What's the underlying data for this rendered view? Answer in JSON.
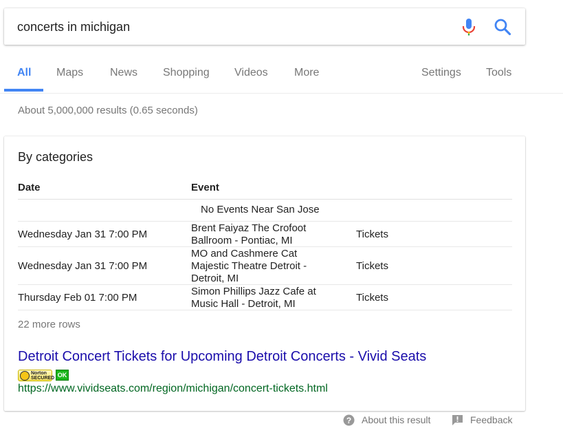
{
  "search": {
    "query": "concerts in michigan"
  },
  "nav": {
    "tabs": [
      {
        "label": "All"
      },
      {
        "label": "Maps"
      },
      {
        "label": "News"
      },
      {
        "label": "Shopping"
      },
      {
        "label": "Videos"
      },
      {
        "label": "More"
      }
    ],
    "settings_label": "Settings",
    "tools_label": "Tools",
    "active": "All"
  },
  "stats": "About 5,000,000 results (0.65 seconds)",
  "card": {
    "title": "By categories",
    "columns": {
      "date": "Date",
      "event": "Event"
    },
    "no_events": "No Events Near San Jose",
    "rows": [
      {
        "date": "Wednesday Jan 31 7:00 PM",
        "event": "Brent Faiyaz The Crofoot Ballroom - Pontiac, MI",
        "tickets": "Tickets"
      },
      {
        "date": "Wednesday Jan 31 7:00 PM",
        "event": "MO and Cashmere Cat Majestic Theatre Detroit - Detroit, MI",
        "tickets": "Tickets"
      },
      {
        "date": "Thursday Feb 01 7:00 PM",
        "event": "Simon Phillips Jazz Cafe at Music Hall - Detroit, MI",
        "tickets": "Tickets"
      }
    ],
    "more_rows": "22 more rows"
  },
  "result": {
    "title": "Detroit Concert Tickets for Upcoming Detroit Concerts - Vivid Seats",
    "norton_text": "Norton SECURED",
    "ok_text": "OK",
    "url": "https://www.vividseats.com/region/michigan/concert-tickets.html"
  },
  "footer": {
    "about": "About this result",
    "feedback": "Feedback"
  },
  "colors": {
    "link": "#1a0dab",
    "url": "#006621",
    "active_tab": "#4285f4",
    "muted": "#777777"
  }
}
